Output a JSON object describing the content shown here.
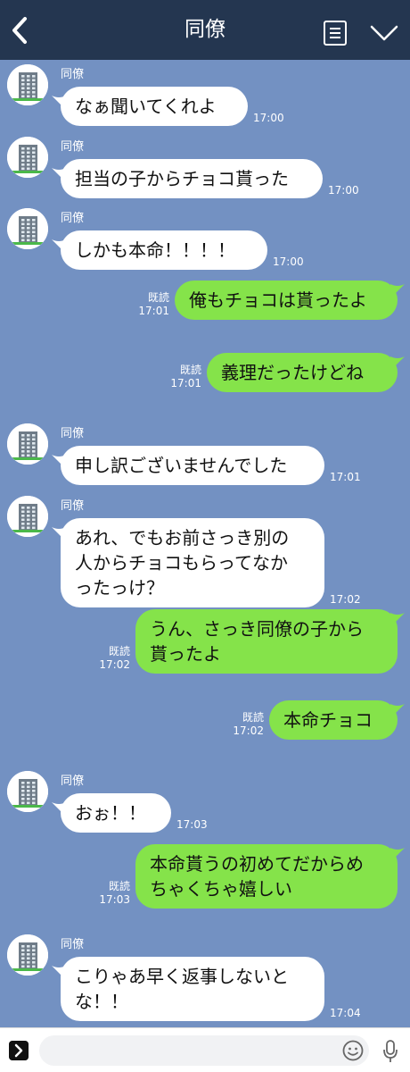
{
  "header": {
    "title": "同僚"
  },
  "messages": [
    {
      "side": "in",
      "sender": "同僚",
      "lines": [
        "なぁ聞いてくれよ"
      ],
      "time": "17:00"
    },
    {
      "side": "in",
      "sender": "同僚",
      "lines": [
        "担当の子からチョコ貰った"
      ],
      "time": "17:00"
    },
    {
      "side": "in",
      "sender": "同僚",
      "lines": [
        "しかも本命！！！！"
      ],
      "time": "17:00"
    },
    {
      "side": "out",
      "read": "既読",
      "lines": [
        "俺もチョコは貰ったよ"
      ],
      "time": "17:01"
    },
    {
      "side": "out",
      "read": "既読",
      "lines": [
        "義理だったけどね"
      ],
      "time": "17:01"
    },
    {
      "side": "in",
      "sender": "同僚",
      "lines": [
        "申し訳ございませんでした"
      ],
      "time": "17:01"
    },
    {
      "side": "in",
      "sender": "同僚",
      "lines": [
        "あれ、でもお前さっき別の",
        "人からチョコもらってなか",
        "ったっけ？"
      ],
      "time": "17:02"
    },
    {
      "side": "out",
      "read": "既読",
      "lines": [
        "うん、さっき同僚の子から",
        "貰ったよ"
      ],
      "time": "17:02"
    },
    {
      "side": "out",
      "read": "既読",
      "lines": [
        "本命チョコ"
      ],
      "time": "17:02"
    },
    {
      "side": "in",
      "sender": "同僚",
      "lines": [
        "おぉ！！"
      ],
      "time": "17:03"
    },
    {
      "side": "out",
      "read": "既読",
      "lines": [
        "本命貰うの初めてだからめ",
        "ちゃくちゃ嬉しい"
      ],
      "time": "17:03"
    },
    {
      "side": "in",
      "sender": "同僚",
      "lines": [
        "こりゃあ早く返事しないと",
        "な！！"
      ],
      "time": "17:04"
    }
  ],
  "footer": {
    "input_placeholder": ""
  },
  "icons": {
    "back": "chevron-left-icon",
    "menu": "menu-list-icon",
    "collapse": "chevron-down-icon",
    "expand": "chevron-right-icon",
    "emoji": "emoji-icon",
    "mic": "microphone-icon",
    "avatar": "building-icon"
  },
  "colors": {
    "header_bg": "#243650",
    "chat_bg": "#7391c2",
    "incoming_bubble": "#ffffff",
    "outgoing_bubble": "#85e34a"
  }
}
